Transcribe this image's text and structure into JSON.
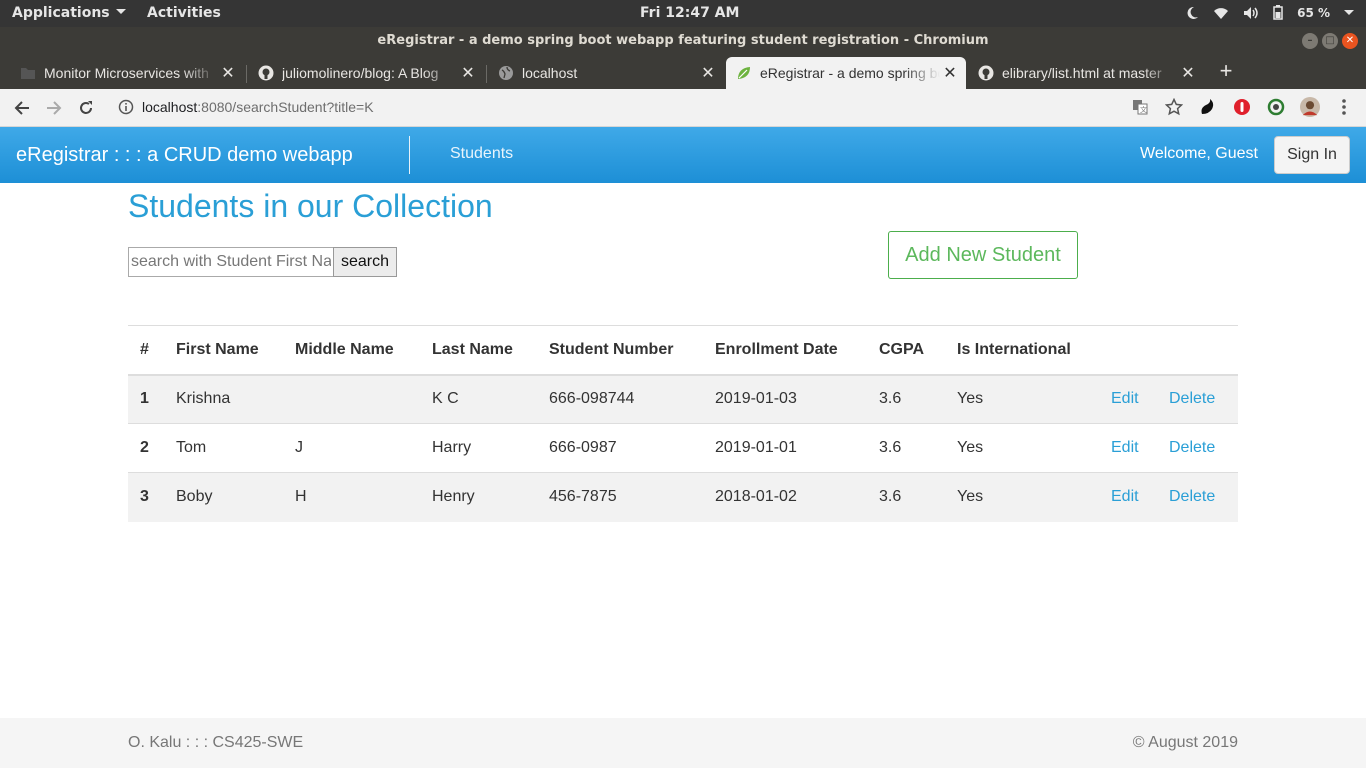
{
  "os": {
    "applications_label": "Applications",
    "activities_label": "Activities",
    "clock": "Fri 12:47 AM",
    "battery": "65 %"
  },
  "browser": {
    "window_title": "eRegistrar - a demo spring boot webapp featuring student registration - Chromium",
    "tabs": [
      {
        "label": "Monitor Microservices with"
      },
      {
        "label": "juliomolinero/blog: A Blog"
      },
      {
        "label": "localhost"
      },
      {
        "label": "eRegistrar - a demo spring boot"
      },
      {
        "label": "elibrary/list.html at master"
      }
    ],
    "url_host": "localhost",
    "url_path": ":8080/searchStudent?title=K"
  },
  "navbar": {
    "brand": "eRegistrar : : : a CRUD demo webapp",
    "students_link": "Students",
    "welcome": "Welcome, Guest",
    "signin_label": "Sign In"
  },
  "main": {
    "title": "Students in our Collection",
    "search_placeholder": "search with Student First Name",
    "search_label": "search",
    "add_label": "Add New Student"
  },
  "table": {
    "headers": [
      "#",
      "First Name",
      "Middle Name",
      "Last Name",
      "Student Number",
      "Enrollment Date",
      "CGPA",
      "Is International"
    ],
    "rows": [
      {
        "num": "1",
        "first": "Krishna",
        "middle": "",
        "last": "K C",
        "student_number": "666-098744",
        "enrollment": "2019-01-03",
        "cgpa": "3.6",
        "intl": "Yes"
      },
      {
        "num": "2",
        "first": "Tom",
        "middle": "J",
        "last": "Harry",
        "student_number": "666-0987",
        "enrollment": "2019-01-01",
        "cgpa": "3.6",
        "intl": "Yes"
      },
      {
        "num": "3",
        "first": "Boby",
        "middle": "H",
        "last": "Henry",
        "student_number": "456-7875",
        "enrollment": "2018-01-02",
        "cgpa": "3.6",
        "intl": "Yes"
      }
    ],
    "edit_label": "Edit",
    "delete_label": "Delete"
  },
  "footer": {
    "left": "O. Kalu : : : CS425-SWE",
    "right": "© August 2019"
  },
  "colors": {
    "accent": "#2a9fd6",
    "navbar": "#1d8fd6",
    "success": "#5cb85c"
  }
}
